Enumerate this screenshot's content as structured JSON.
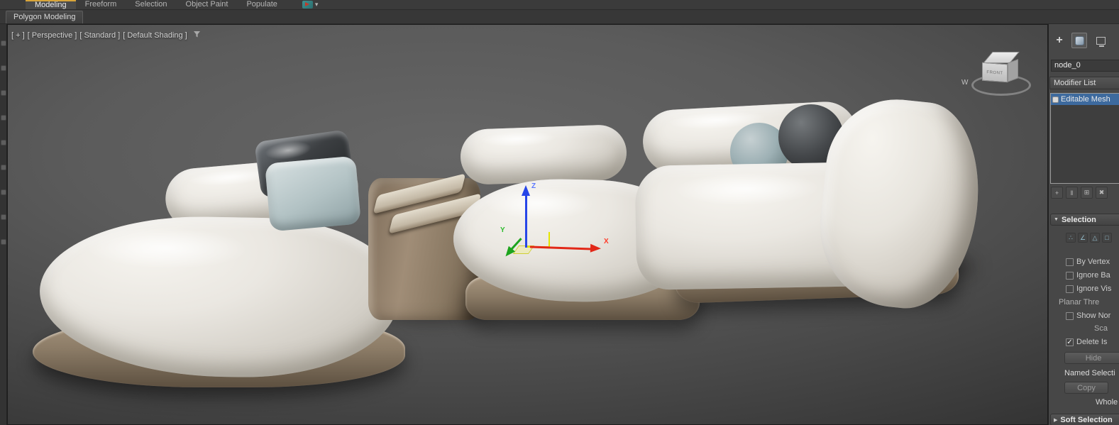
{
  "ribbon": {
    "tabs": [
      {
        "label": "Modeling",
        "active": true
      },
      {
        "label": "Freeform",
        "active": false
      },
      {
        "label": "Selection",
        "active": false
      },
      {
        "label": "Object Paint",
        "active": false
      },
      {
        "label": "Populate",
        "active": false
      }
    ],
    "panel_tab": "Polygon Modeling"
  },
  "viewport": {
    "label": {
      "general": "[ + ]",
      "pov": "[ Perspective ]",
      "renderer": "[ Standard ]",
      "shading": "[ Default Shading ]"
    },
    "viewcube": {
      "front_label": "FRONT",
      "compass_w": "W"
    },
    "gizmo": {
      "x": "X",
      "y": "Y",
      "z": "Z"
    }
  },
  "command_panel": {
    "object_name": "node_0",
    "modifier_list": "Modifier List",
    "stack": [
      {
        "label": "Editable Mesh",
        "selected": true
      }
    ],
    "selection": {
      "title": "Selection",
      "by_vertex": "By Vertex",
      "ignore_backfacing": "Ignore Ba",
      "ignore_visible": "Ignore Vis",
      "planar_threshold": "Planar Thre",
      "show_normals": "Show Nor",
      "scale": "Sca",
      "delete_isolated": "Delete Is",
      "delete_isolated_check": "✓",
      "hide": "Hide",
      "named_selections": "Named Selecti",
      "copy": "Copy",
      "status": "Whole"
    },
    "soft_selection_title": "Soft Selection"
  },
  "icons": {
    "rollout_expanded": "▼",
    "rollout_collapsed": "▶",
    "dropdown_caret": "▾",
    "plus": "+",
    "pin_stack": "+",
    "show_end_result": "‖",
    "make_unique": "⊞",
    "remove_modifier": "✖",
    "vertex": "∴",
    "edge": "∠",
    "face": "△",
    "polygon": "□"
  },
  "colors": {
    "selection_highlight": "#3d6a9e",
    "active_tab_accent": "#d8a53a",
    "viewport_bg_light": "#666666",
    "viewport_bg_dark": "#343434"
  }
}
